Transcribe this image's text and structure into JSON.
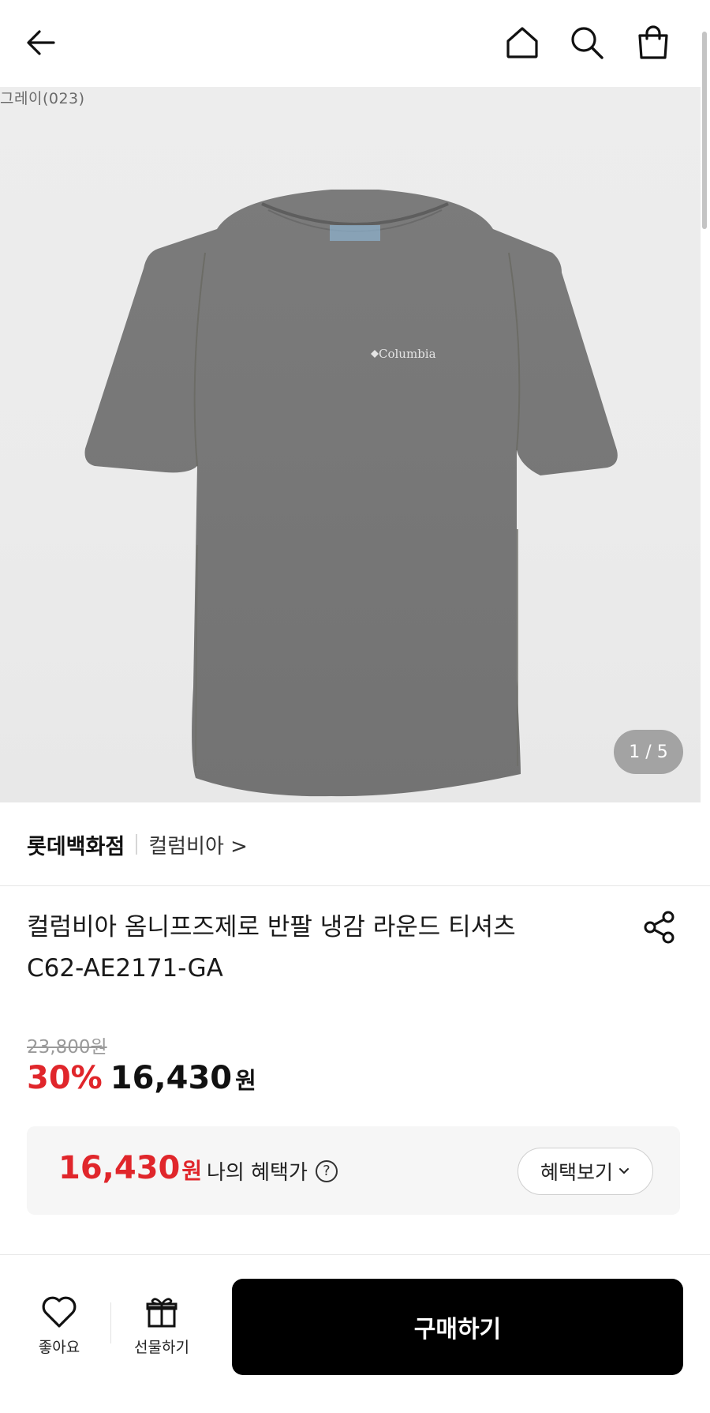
{
  "header": {
    "back_icon": "arrow-left-icon",
    "home_icon": "home-icon",
    "search_icon": "search-icon",
    "bag_icon": "shopping-bag-icon"
  },
  "hero": {
    "color_label": "그레이(023)",
    "image_logo": "Columbia",
    "page_indicator": "1 / 5"
  },
  "brand": {
    "store": "롯데백화점",
    "brand_link": "컬럼비아 >"
  },
  "product": {
    "title_line1": "컬럼비아 옴니프즈제로 반팔 냉감 라운드 티셔츠",
    "title_line2": "C62-AE2171-GA"
  },
  "price": {
    "original": "23,800원",
    "discount": "30%",
    "sale": "16,430",
    "sale_unit": "원",
    "accent_color": "#e0262b"
  },
  "benefit": {
    "price": "16,430",
    "unit": "원",
    "label": "나의 혜택가",
    "help": "?",
    "button": "혜택보기"
  },
  "bottom_bar": {
    "like_label": "좋아요",
    "gift_label": "선물하기",
    "buy_label": "구매하기"
  }
}
